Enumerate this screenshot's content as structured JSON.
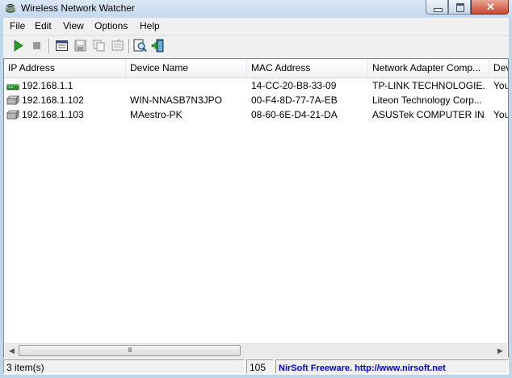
{
  "window": {
    "title": "Wireless Network Watcher",
    "close_glyph": "✕"
  },
  "menu": [
    "File",
    "Edit",
    "View",
    "Options",
    "Help"
  ],
  "toolbar": {
    "icons": [
      "play-icon",
      "stop-icon",
      "html-report-icon",
      "save-icon",
      "copy-icon",
      "properties-icon",
      "find-icon",
      "exit-icon"
    ]
  },
  "table": {
    "columns": [
      "IP Address",
      "Device Name",
      "MAC Address",
      "Network Adapter Comp...",
      "Dev"
    ],
    "rows": [
      {
        "icon": "router-icon",
        "ip": "192.168.1.1",
        "name": "",
        "mac": "14-CC-20-B8-33-09",
        "vendor": "TP-LINK TECHNOLOGIE...",
        "info": "You"
      },
      {
        "icon": "computer-icon",
        "ip": "192.168.1.102",
        "name": "WIN-NNASB7N3JPO",
        "mac": "00-F4-8D-77-7A-EB",
        "vendor": "Liteon Technology Corp...",
        "info": ""
      },
      {
        "icon": "computer-icon",
        "ip": "192.168.1.103",
        "name": "MAestro-PK",
        "mac": "08-60-6E-D4-21-DA",
        "vendor": "ASUSTek COMPUTER IN...",
        "info": "You"
      }
    ]
  },
  "scrollbar": {
    "left_arrow": "◀",
    "right_arrow": "▶",
    "grip": "III"
  },
  "status": {
    "items": "3 item(s)",
    "count": "105",
    "credit": "NirSoft Freeware.  http://www.nirsoft.net"
  }
}
